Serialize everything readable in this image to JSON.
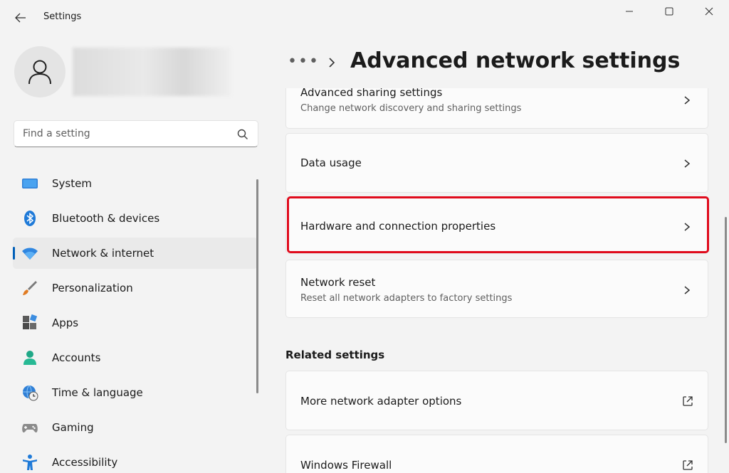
{
  "window": {
    "title": "Settings"
  },
  "sidebar": {
    "search": {
      "placeholder": "Find a setting"
    },
    "items": [
      {
        "label": "System",
        "icon": "monitor-icon"
      },
      {
        "label": "Bluetooth & devices",
        "icon": "bluetooth-icon"
      },
      {
        "label": "Network & internet",
        "icon": "wifi-icon",
        "selected": true
      },
      {
        "label": "Personalization",
        "icon": "paintbrush-icon"
      },
      {
        "label": "Apps",
        "icon": "apps-icon"
      },
      {
        "label": "Accounts",
        "icon": "person-icon"
      },
      {
        "label": "Time & language",
        "icon": "globe-clock-icon"
      },
      {
        "label": "Gaming",
        "icon": "gamepad-icon"
      },
      {
        "label": "Accessibility",
        "icon": "accessibility-icon"
      }
    ]
  },
  "header": {
    "breadcrumb_more": "•••",
    "title": "Advanced network settings"
  },
  "main": {
    "cards": [
      {
        "title": "Advanced sharing settings",
        "subtitle": "Change network discovery and sharing settings"
      },
      {
        "title": "Data usage"
      },
      {
        "title": "Hardware and connection properties",
        "highlighted": true
      },
      {
        "title": "Network reset",
        "subtitle": "Reset all network adapters to factory settings"
      }
    ],
    "related": {
      "heading": "Related settings",
      "cards": [
        {
          "title": "More network adapter options"
        },
        {
          "title": "Windows Firewall"
        }
      ]
    }
  },
  "colors": {
    "accent": "#005fb8",
    "highlight": "#e00b1c",
    "background": "#f3f3f3",
    "card": "#fbfbfb"
  }
}
